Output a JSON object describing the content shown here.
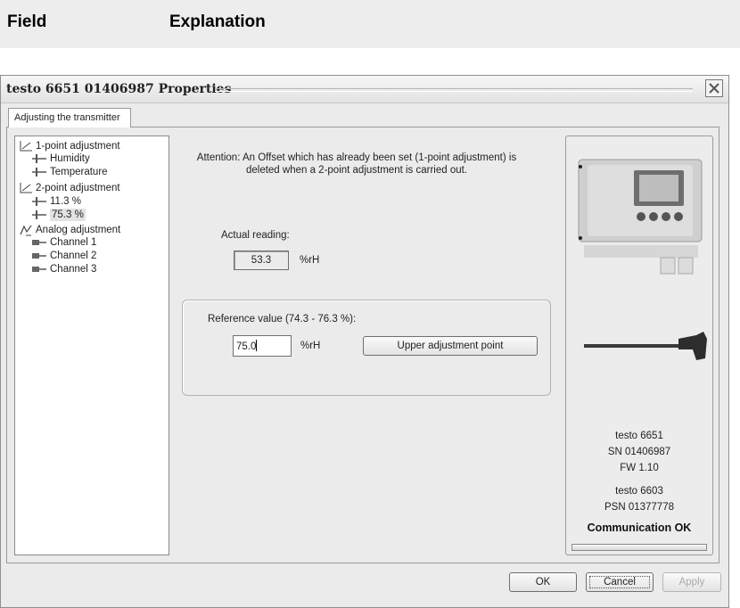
{
  "table_header": {
    "field": "Field",
    "explanation": "Explanation"
  },
  "dialog": {
    "title": "testo 6651  01406987 Properties",
    "tab": "Adjusting the transmitter",
    "tree": {
      "one_point": "1-point adjustment",
      "humidity": "Humidity",
      "temperature": "Temperature",
      "two_point": "2-point adjustment",
      "p113": "11.3 %",
      "p753": "75.3 %",
      "analog": "Analog adjustment",
      "ch1": "Channel 1",
      "ch2": "Channel 2",
      "ch3": "Channel 3"
    },
    "attention": "Attention: An Offset which has already been set (1-point adjustment) is deleted when a 2-point adjustment is carried out.",
    "actual_label": "Actual reading:",
    "actual_value": "53.3",
    "actual_unit": "%rH",
    "reference_label": "Reference value (74.3 - 76.3 %):",
    "reference_value": "75.0",
    "reference_unit": "%rH",
    "upper_button": "Upper adjustment point",
    "device": {
      "model": "testo 6651",
      "serial": "SN 01406987",
      "firmware": "FW  1.10",
      "probe_model": "testo 6603",
      "probe_serial": "PSN 01377778",
      "status": "Communication OK"
    },
    "buttons": {
      "ok": "OK",
      "cancel": "Cancel",
      "apply": "Apply"
    }
  }
}
